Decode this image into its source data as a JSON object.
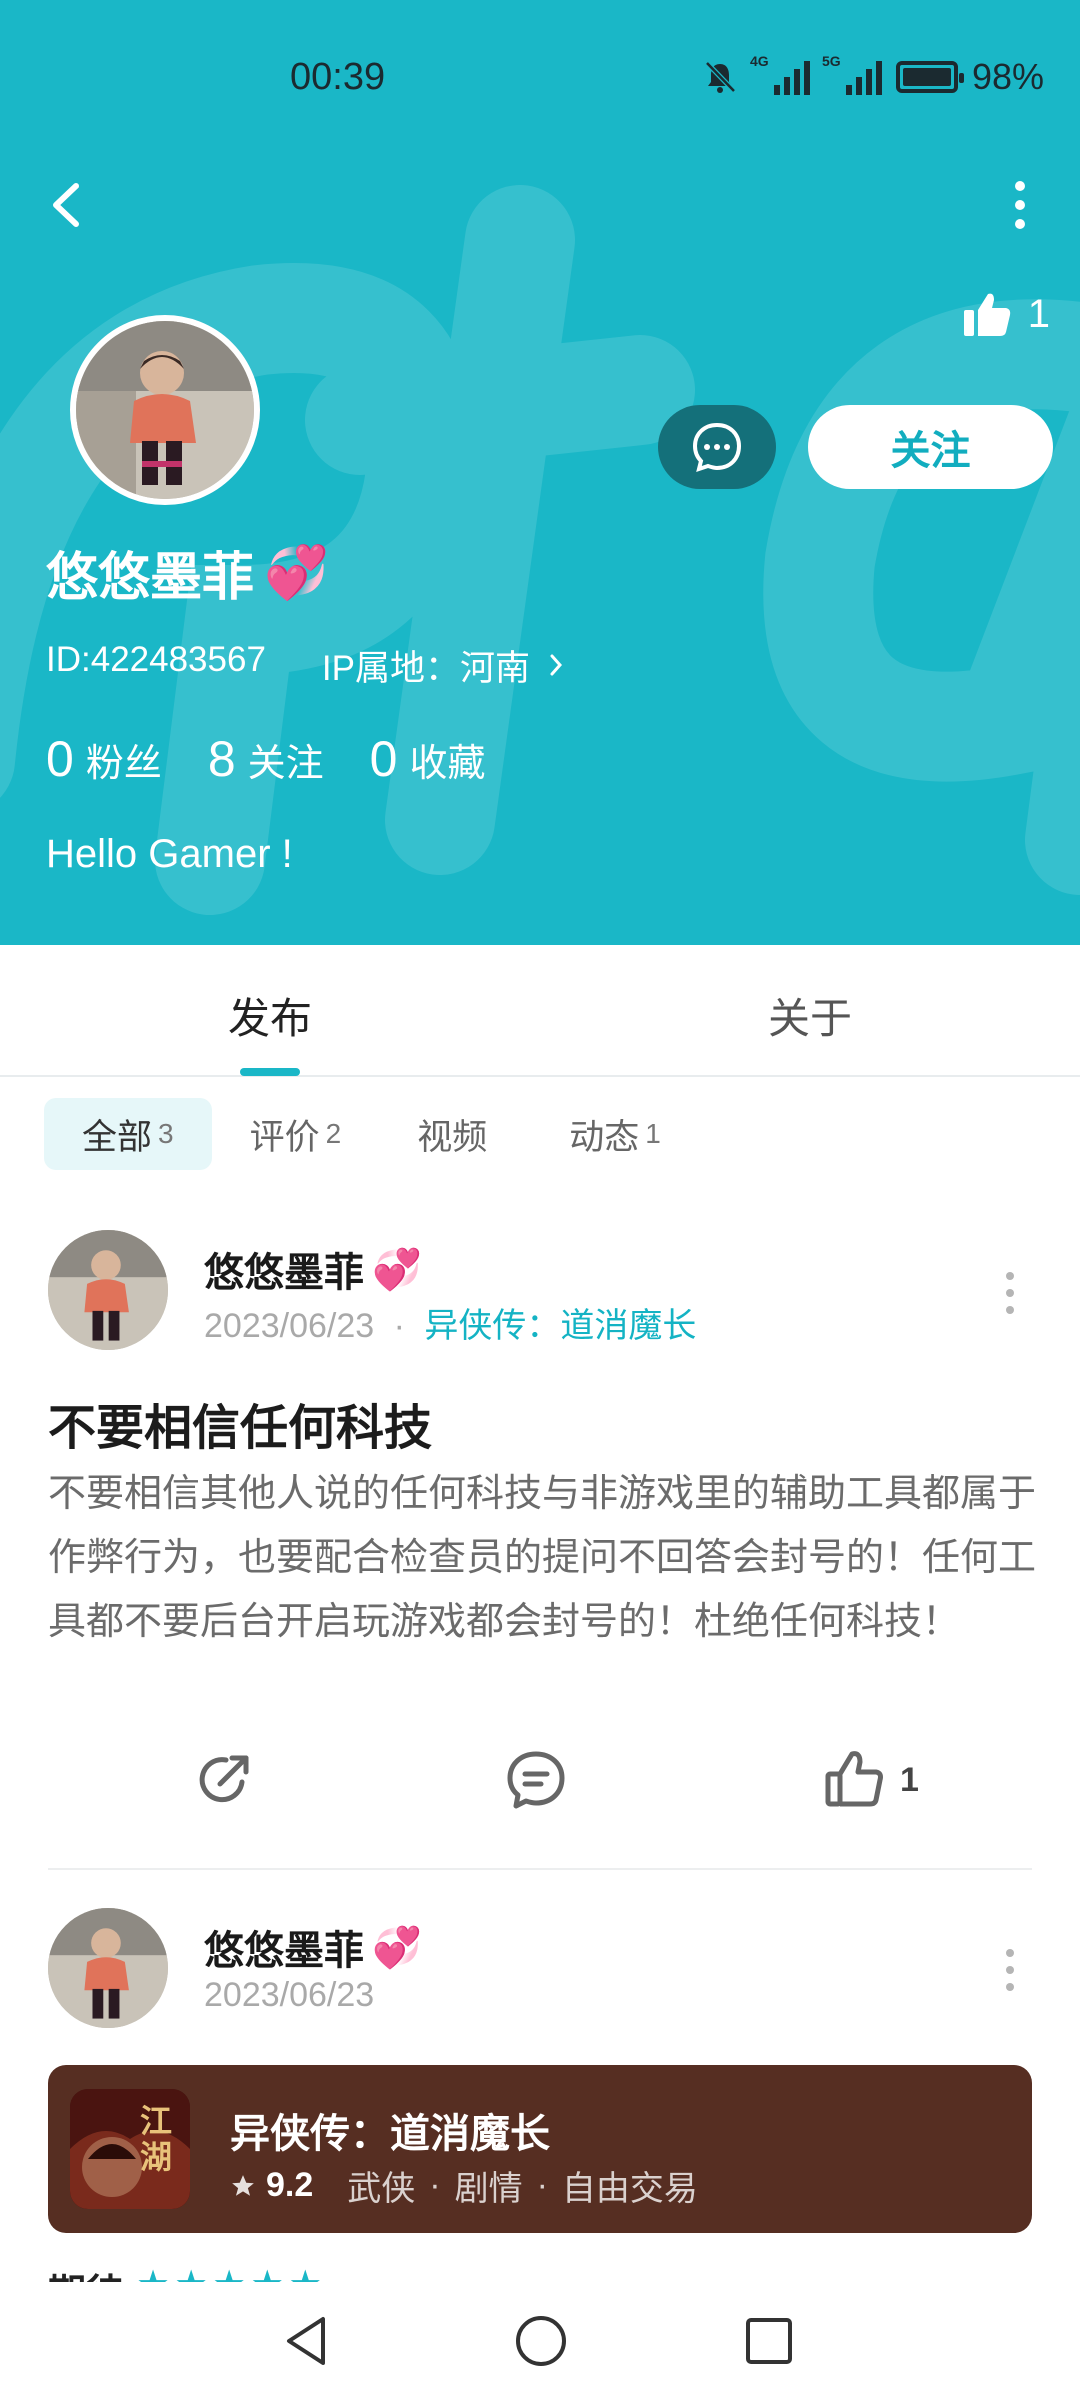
{
  "status_bar": {
    "time": "00:39",
    "battery_percent": "98%",
    "signal_1_label": "4G",
    "signal_2_label": "5G"
  },
  "profile": {
    "like_count": "1",
    "name": "悠悠墨菲",
    "name_emoji": "💞",
    "id_text": "ID:422483567",
    "ip_text": "IP属地：河南",
    "follow_label": "关注",
    "stats": [
      {
        "num": "0",
        "label": "粉丝"
      },
      {
        "num": "8",
        "label": "关注"
      },
      {
        "num": "0",
        "label": "收藏"
      }
    ],
    "bio": "Hello Gamer !"
  },
  "tabs": {
    "publish": "发布",
    "about": "关于"
  },
  "filters": [
    {
      "label": "全部",
      "count": "3"
    },
    {
      "label": "评价",
      "count": "2"
    },
    {
      "label": "视频",
      "count": ""
    },
    {
      "label": "动态",
      "count": "1"
    }
  ],
  "posts": [
    {
      "author": "悠悠墨菲",
      "emoji": "💞",
      "date": "2023/06/23",
      "dot": "·",
      "game": "异侠传：道消魔长",
      "title": "不要相信任何科技",
      "body": "不要相信其他人说的任何科技与非游戏里的辅助工具都属于作弊行为，也要配合检查员的提问不回答会封号的！任何工具都不要后台开启玩游戏都会封号的！杜绝任何科技！",
      "like_count": "1"
    },
    {
      "author": "悠悠墨菲",
      "emoji": "💞",
      "date": "2023/06/23"
    }
  ],
  "game_card": {
    "title": "异侠传：道消魔长",
    "icon_text": "江湖",
    "rating": "9.2",
    "tags": [
      "武侠",
      "剧情",
      "自由交易"
    ],
    "dot": "·"
  },
  "peek": {
    "label": "期待",
    "stars": "★★★★★"
  },
  "colors": {
    "accent": "#1ab7c7",
    "game_card_bg": "#562e22"
  }
}
